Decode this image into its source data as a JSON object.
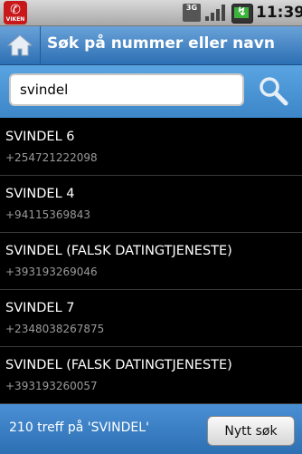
{
  "statusbar": {
    "app_icon_label": "VIKEN",
    "network": "3G",
    "time": "11:39"
  },
  "header": {
    "title": "Søk på nummer eller navn"
  },
  "search": {
    "value": "svindel"
  },
  "results": [
    {
      "name": "SVINDEL 6",
      "number": "+254721222098"
    },
    {
      "name": "SVINDEL 4",
      "number": "+94115369843"
    },
    {
      "name": "SVINDEL (FALSK DATINGTJENESTE)",
      "number": "+393193269046"
    },
    {
      "name": "SVINDEL 7",
      "number": "+2348038267875"
    },
    {
      "name": "SVINDEL (FALSK DATINGTJENESTE)",
      "number": "+393193260057"
    }
  ],
  "footer": {
    "count_text": "210 treff på 'SVINDEL'",
    "new_search_label": "Nytt søk"
  },
  "colors": {
    "accent_blue": "#3c86c9",
    "list_background": "#000000",
    "number_gray": "#9a9a9a"
  },
  "icons": {
    "home": "home-icon",
    "search": "magnifier-icon",
    "signal": "signal-icon",
    "battery": "battery-charging-icon"
  }
}
